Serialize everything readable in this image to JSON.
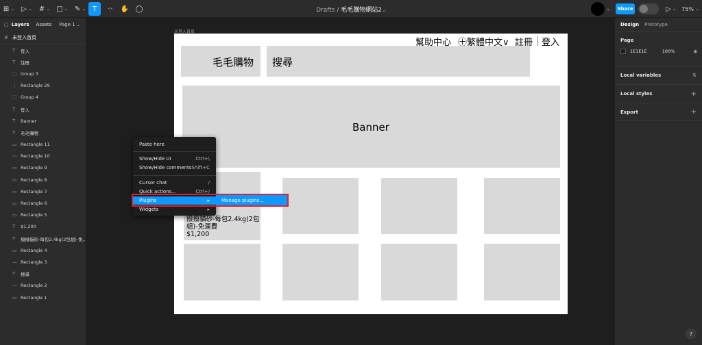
{
  "toolbar": {
    "tools": {
      "main_menu": "⊞",
      "move": "▷",
      "frame": "#",
      "shape": "□",
      "pen": "✎",
      "text": "T",
      "resources": "⁘",
      "hand": "✋",
      "comment": "◯"
    },
    "breadcrumb": {
      "parent": "Drafts",
      "sep": "/",
      "file": "毛毛購物網站2"
    },
    "share_label": "Share",
    "zoom": "75%",
    "present_icon": "▷"
  },
  "left_panel": {
    "tabs": {
      "layers": "Layers",
      "assets": "Assets",
      "page": "Page 1"
    },
    "page_name": "未登入首頁",
    "layers": [
      {
        "icon": "T",
        "name": "登入"
      },
      {
        "icon": "T",
        "name": "註冊"
      },
      {
        "icon": "⬚",
        "name": "Group 3"
      },
      {
        "icon": "⋮",
        "name": "Rectangle 29"
      },
      {
        "icon": "⬚",
        "name": "Group 4"
      },
      {
        "icon": "T",
        "name": "登入"
      },
      {
        "icon": "T",
        "name": "Banner"
      },
      {
        "icon": "T",
        "name": "毛毛購物"
      },
      {
        "icon": "▭",
        "name": "Rectangle 11"
      },
      {
        "icon": "▭",
        "name": "Rectangle 10"
      },
      {
        "icon": "▭",
        "name": "Rectangle 9"
      },
      {
        "icon": "▭",
        "name": "Rectangle 8"
      },
      {
        "icon": "▭",
        "name": "Rectangle 7"
      },
      {
        "icon": "▭",
        "name": "Rectangle 6"
      },
      {
        "icon": "▭",
        "name": "Rectangle 5"
      },
      {
        "icon": "T",
        "name": "$1,200"
      },
      {
        "icon": "T",
        "name": "撥撥貓砂-每包2.4kg(2包組)-免..."
      },
      {
        "icon": "▭",
        "name": "Rectangle 4"
      },
      {
        "icon": "—",
        "name": "Rectangle 3"
      },
      {
        "icon": "T",
        "name": "搜尋"
      },
      {
        "icon": "—",
        "name": "Rectangle 2"
      },
      {
        "icon": "▭",
        "name": "Rectangle 1"
      }
    ]
  },
  "right_panel": {
    "tabs": {
      "design": "Design",
      "prototype": "Prototype"
    },
    "page_section": "Page",
    "page_color": "1E1E1E",
    "page_opacity": "100%",
    "local_variables": "Local variables",
    "local_styles": "Local styles",
    "export": "Export"
  },
  "canvas": {
    "frame_label": "未登入首頁",
    "header": {
      "help": "幫助中心",
      "lang": "㊉繁體中文∨",
      "register": "註冊",
      "login": "登入",
      "logo": "毛毛購物",
      "search": "搜尋"
    },
    "banner": "Banner",
    "product": {
      "name": "撥撥貓砂-每包2.4kg(2包組)-免運費",
      "price": "$1,200"
    }
  },
  "context_menu": {
    "items": [
      {
        "label": "Paste here",
        "shortcut": ""
      },
      {
        "label": "Show/Hide UI",
        "shortcut": "Ctrl+\\"
      },
      {
        "label": "Show/Hide comments",
        "shortcut": "Shift+C"
      },
      {
        "label": "Cursor chat",
        "shortcut": "/"
      },
      {
        "label": "Quick actions...",
        "shortcut": "Ctrl+/"
      },
      {
        "label": "Plugins",
        "shortcut": "▸"
      },
      {
        "label": "Widgets",
        "shortcut": "▸"
      }
    ],
    "submenu_item": "Manage plugins...",
    "highlight_color": "#0d99ff",
    "annotation_color": "#e0212f"
  },
  "help_label": "?"
}
